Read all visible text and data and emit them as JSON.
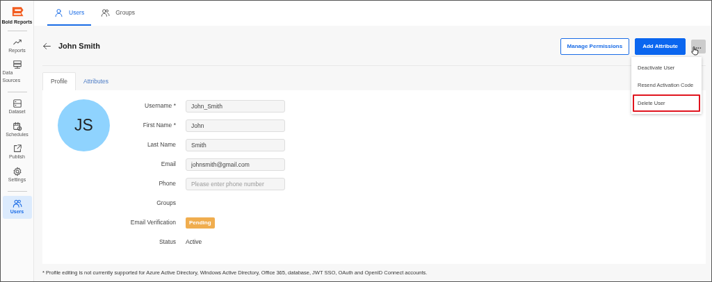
{
  "sidebar": {
    "logo": "Bold Reports",
    "groups": [
      [
        {
          "label": "Reports",
          "selected": false
        },
        {
          "label": "Data Sources",
          "selected": false
        }
      ],
      [
        {
          "label": "Dataset",
          "selected": false
        },
        {
          "label": "Schedules",
          "selected": false
        },
        {
          "label": "Publish",
          "selected": false
        },
        {
          "label": "Settings",
          "selected": false
        }
      ],
      [
        {
          "label": "Users",
          "selected": true
        }
      ]
    ]
  },
  "top_tabs": [
    {
      "label": "Users",
      "selected": true
    },
    {
      "label": "Groups",
      "selected": false
    }
  ],
  "header": {
    "title": "John Smith",
    "buttons": [
      {
        "label": "Manage Permissions",
        "kind": "outline"
      },
      {
        "label": "Add Attribute",
        "kind": "primary"
      },
      {
        "label": "...",
        "kind": "more"
      }
    ]
  },
  "menu": [
    {
      "label": "Deactivate User",
      "highlighted": false
    },
    {
      "label": "Resend Activation Code",
      "highlighted": false
    },
    {
      "label": "Delete User",
      "highlighted": true
    }
  ],
  "tabs": [
    {
      "label": "Profile",
      "selected": true
    },
    {
      "label": "Attributes",
      "selected": false
    }
  ],
  "avatar": {
    "initials": "JS",
    "color": "#8fd3fe"
  },
  "fields": [
    {
      "label": "Username *",
      "kind": "input",
      "value": "John_Smith"
    },
    {
      "label": "First Name *",
      "kind": "input",
      "value": "John"
    },
    {
      "label": "Last Name",
      "kind": "input",
      "value": "Smith"
    },
    {
      "label": "Email",
      "kind": "input",
      "value": "johnsmith@gmail.com"
    },
    {
      "label": "Phone",
      "kind": "input",
      "placeholder": "Please enter phone number"
    },
    {
      "label": "Groups",
      "kind": "empty"
    },
    {
      "label": "Email Verification",
      "kind": "badge",
      "value": "Pending"
    },
    {
      "label": "Status",
      "kind": "text",
      "value": "Active"
    }
  ],
  "footnote": "* Profile editing is not currently supported for Azure Active Directory, Windows Active Directory, Office 365, database, JWT SSO, OAuth and OpenID Connect accounts."
}
